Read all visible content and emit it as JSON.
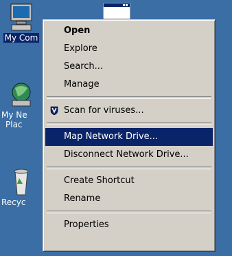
{
  "desktop": {
    "icons": [
      {
        "name": "my-computer",
        "label": "My Com"
      },
      {
        "name": "network-places",
        "label_line1": "My Ne",
        "label_line2": "Plac"
      },
      {
        "name": "recycle-bin",
        "label": "Recyc"
      }
    ]
  },
  "context_menu": {
    "items": [
      {
        "label": "Open",
        "bold": true
      },
      {
        "label": "Explore"
      },
      {
        "label": "Search..."
      },
      {
        "label": "Manage"
      },
      {
        "label": "Scan for viruses...",
        "icon": "shield-icon"
      },
      {
        "label": "Map Network Drive...",
        "highlighted": true
      },
      {
        "label": "Disconnect Network Drive..."
      },
      {
        "label": "Create Shortcut"
      },
      {
        "label": "Rename"
      },
      {
        "label": "Properties"
      }
    ]
  },
  "colors": {
    "desktop": "#3a6ea5",
    "menu_bg": "#d4d0c8",
    "highlight": "#0a246a"
  }
}
